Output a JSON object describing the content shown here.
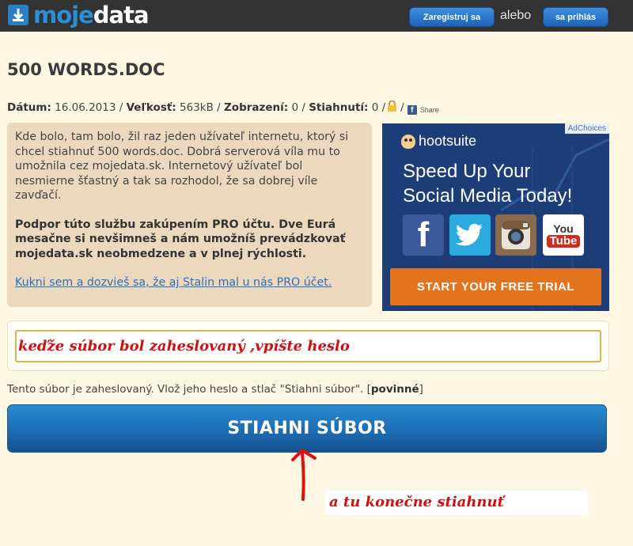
{
  "header": {
    "logo_part1": "moje",
    "logo_part2": "data",
    "register_label": "Zaregistruj sa",
    "or_label": "alebo",
    "login_label": "sa prihlás"
  },
  "file": {
    "title": "500 WORDS.DOC",
    "date_label": "Dátum:",
    "date": "16.06.2013",
    "size_label": "Veľkosť:",
    "size": "563kB",
    "views_label": "Zobrazení:",
    "views": "0",
    "downloads_label": "Stiahnutí:",
    "downloads": "0",
    "share_label": "Share"
  },
  "info": {
    "story": "Kde bolo, tam bolo, žil raz jeden užívateľ internetu, ktorý si chcel stiahnuť 500 words.doc. Dobrá serverová víla mu to umožnila cez mojedata.sk. Internetový užívateľ bol nesmierne šťastný a tak sa rozhodol, že sa dobrej víle zavďačí.",
    "support": "Podpor túto službu zakúpením PRO účtu. Dve Eurá mesačne si nevšimneš a nám umožníš prevádzkovať mojedata.sk neobmedzene a v plnej rýchlosti.",
    "link": "Kukni sem a dozvieš sa, že aj Stalin mal u nás PRO účet."
  },
  "ad": {
    "ad_choices": "AdChoices",
    "brand": "hootsuite",
    "headline_line1": "Speed Up Your",
    "headline_line2": "Social Media Today!",
    "youtube_you": "You",
    "youtube_tube": "Tube",
    "cta": "START YOUR FREE TRIAL"
  },
  "password": {
    "annotation": "keďže súbor bol zaheslovaný ,vpíšte heslo",
    "instruction": "Tento súbor je zaheslovaný. Vlož jeho heslo a stlač \"Stiahni súbor\". [",
    "required": "povinné",
    "instruction_end": "]"
  },
  "download": {
    "button_label": "STIAHNI SÚBOR",
    "annotation": "a tu konečne stiahnuť"
  },
  "colors": {
    "header_bg": "#333333",
    "accent_blue": "#1d6db4",
    "annotation_red": "#d01010",
    "ad_bg": "#1c3d78",
    "ad_cta": "#e4731e"
  }
}
